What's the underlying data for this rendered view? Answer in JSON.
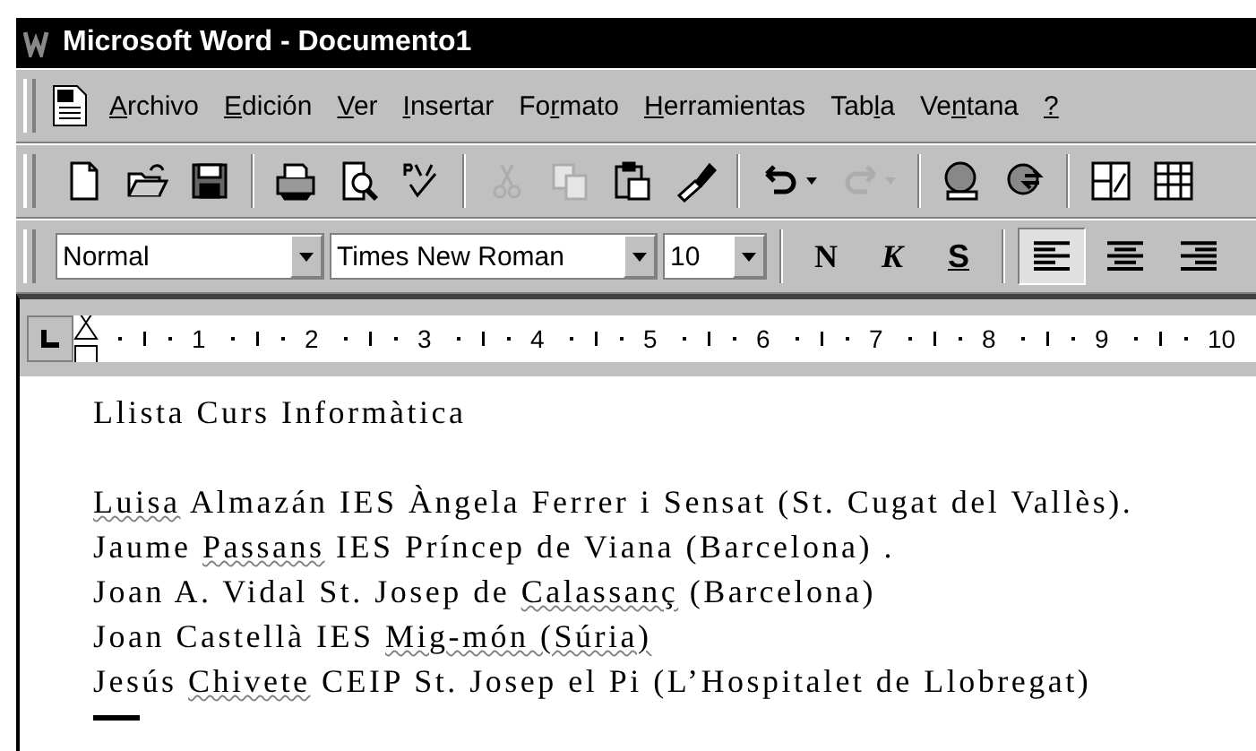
{
  "window": {
    "title": "Microsoft Word - Documento1"
  },
  "menu": [
    {
      "key": "A",
      "after": "rchivo"
    },
    {
      "key": "E",
      "after": "dición"
    },
    {
      "key": "V",
      "after": "er"
    },
    {
      "key": "I",
      "after": "nsertar"
    },
    {
      "before": "Fo",
      "key": "r",
      "after": "mato"
    },
    {
      "key": "H",
      "after": "erramientas"
    },
    {
      "before": "Tab",
      "key": "l",
      "after": "a"
    },
    {
      "before": "Ve",
      "key": "n",
      "after": "tana"
    },
    {
      "key": "?"
    }
  ],
  "standard_toolbar": [
    [
      {
        "kind": "new",
        "disabled": false
      },
      {
        "kind": "open",
        "disabled": false
      },
      {
        "kind": "save",
        "disabled": false
      }
    ],
    [
      {
        "kind": "print",
        "disabled": false
      },
      {
        "kind": "preview",
        "disabled": false
      },
      {
        "kind": "spelling",
        "disabled": false
      }
    ],
    [
      {
        "kind": "cut",
        "disabled": true
      },
      {
        "kind": "copy",
        "disabled": true
      },
      {
        "kind": "paste",
        "disabled": false
      },
      {
        "kind": "painter",
        "disabled": false
      }
    ],
    [
      {
        "kind": "undo",
        "disabled": false
      },
      {
        "kind": "redo",
        "disabled": true
      }
    ],
    [
      {
        "kind": "web",
        "disabled": false
      },
      {
        "kind": "hyperlink",
        "disabled": false
      }
    ],
    [
      {
        "kind": "tables",
        "disabled": false
      },
      {
        "kind": "table",
        "disabled": false
      }
    ]
  ],
  "format_toolbar": {
    "style": "Normal",
    "font": "Times New Roman",
    "size": "10",
    "bold": "N",
    "italic": "K",
    "underline": "S",
    "align": [
      {
        "kind": "left",
        "selected": true
      },
      {
        "kind": "center",
        "selected": false
      },
      {
        "kind": "right",
        "selected": false
      }
    ]
  },
  "ruler": {
    "marks": [
      "1",
      "2",
      "3",
      "4",
      "5",
      "6",
      "7",
      "8",
      "9",
      "10"
    ]
  },
  "document": {
    "heading": [
      {
        "text": "Llista Curs Informàtica",
        "misspelled": false
      }
    ],
    "lines": [
      [
        {
          "text": "Luisa",
          "misspelled": true
        },
        {
          "text": " Almazán IES Àngela Ferrer i Sensat (St. Cugat del Vallès).",
          "misspelled": false
        }
      ],
      [
        {
          "text": "Jaume ",
          "misspelled": false
        },
        {
          "text": "Passans",
          "misspelled": true
        },
        {
          "text": " IES Príncep de Viana (Barcelona) .",
          "misspelled": false
        }
      ],
      [
        {
          "text": "Joan A. Vidal  St. Josep de ",
          "misspelled": false
        },
        {
          "text": "Calassanç",
          "misspelled": true
        },
        {
          "text": " (Barcelona)",
          "misspelled": false
        }
      ],
      [
        {
          "text": "Joan Castellà IES ",
          "misspelled": false
        },
        {
          "text": "Mig-món (Súria)",
          "misspelled": true
        }
      ],
      [
        {
          "text": "Jesús ",
          "misspelled": false
        },
        {
          "text": "Chivete",
          "misspelled": true
        },
        {
          "text": " CEIP St. Josep el Pi (L’Hospitalet de Llobregat)",
          "misspelled": false
        }
      ]
    ]
  }
}
